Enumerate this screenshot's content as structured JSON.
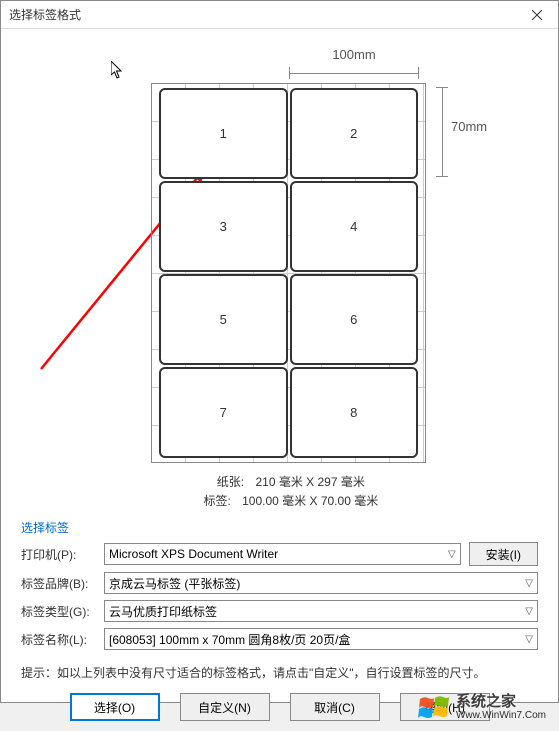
{
  "window": {
    "title": "选择标签格式"
  },
  "preview": {
    "width_label": "100mm",
    "height_label": "70mm",
    "cells": [
      "1",
      "2",
      "3",
      "4",
      "5",
      "6",
      "7",
      "8"
    ]
  },
  "info": {
    "paper_label": "纸张:",
    "paper_value": "210 毫米 X 297 毫米",
    "label_label": "标签:",
    "label_value": "100.00 毫米 X 70.00 毫米"
  },
  "group": {
    "title": "选择标签",
    "printer_label": "打印机(P):",
    "printer_value": "Microsoft XPS Document Writer",
    "install_btn": "安装(I)",
    "brand_label": "标签品牌(B):",
    "brand_value": "京成云马标签 (平张标签)",
    "type_label": "标签类型(G):",
    "type_value": "云马优质打印纸标签",
    "name_label": "标签名称(L):",
    "name_value": "[608053] 100mm x 70mm 圆角8枚/页 20页/盒"
  },
  "hint": "提示：如以上列表中没有尺寸适合的标签格式，请点击\"自定义\"，自行设置标签的尺寸。",
  "buttons": {
    "select": "选择(O)",
    "custom": "自定义(N)",
    "cancel": "取消(C)",
    "help": "帮助(H)"
  },
  "watermark": {
    "cn": "系统之家",
    "en": "Www.WinWin7.Com"
  }
}
